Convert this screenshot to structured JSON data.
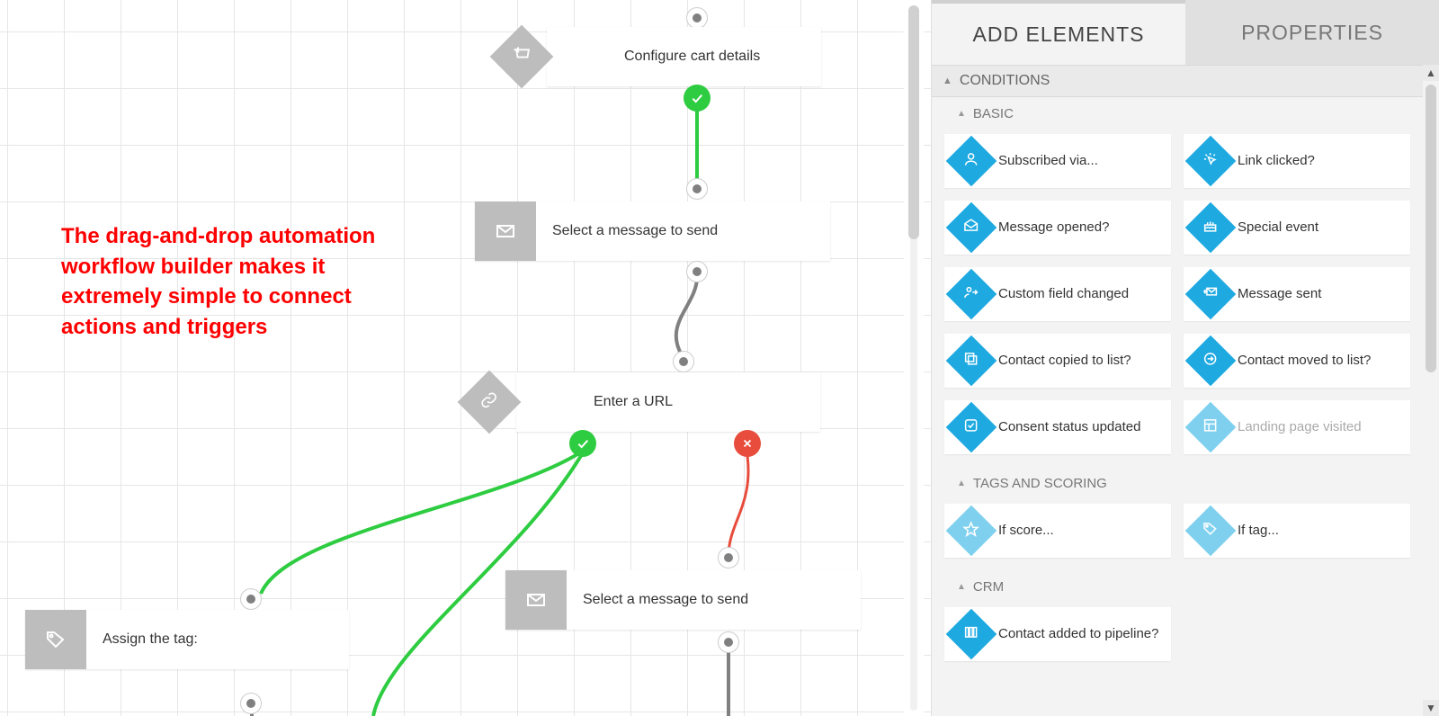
{
  "tabs": {
    "add_elements": "ADD ELEMENTS",
    "properties": "PROPERTIES"
  },
  "sections": {
    "conditions": "CONDITIONS",
    "basic": "BASIC",
    "tags_scoring": "TAGS AND SCORING",
    "crm": "CRM"
  },
  "conditions": {
    "basic": [
      {
        "key": "subscribed-via",
        "label": "Subscribed via...",
        "icon": "person"
      },
      {
        "key": "link-clicked",
        "label": "Link clicked?",
        "icon": "click"
      },
      {
        "key": "message-opened",
        "label": "Message opened?",
        "icon": "envelope-open"
      },
      {
        "key": "special-event",
        "label": "Special event",
        "icon": "cake"
      },
      {
        "key": "custom-field-changed",
        "label": "Custom field changed",
        "icon": "person-arrow"
      },
      {
        "key": "message-sent",
        "label": "Message sent",
        "icon": "envelope-arrow"
      },
      {
        "key": "contact-copied",
        "label": "Contact copied to list?",
        "icon": "copy"
      },
      {
        "key": "contact-moved",
        "label": "Contact moved to list?",
        "icon": "move"
      },
      {
        "key": "consent-updated",
        "label": "Consent status updated",
        "icon": "check-square"
      },
      {
        "key": "landing-page",
        "label": "Landing page visited",
        "icon": "layout",
        "disabled": true
      }
    ],
    "tags_scoring": [
      {
        "key": "if-score",
        "label": "If score...",
        "icon": "star",
        "light": true
      },
      {
        "key": "if-tag",
        "label": "If tag...",
        "icon": "tag",
        "light": true
      }
    ],
    "crm": [
      {
        "key": "contact-pipeline",
        "label": "Contact added to pipeline?",
        "icon": "pipeline"
      }
    ]
  },
  "nodes": {
    "configure_cart": "Configure cart details",
    "select_message_1": "Select a message to send",
    "enter_url": "Enter a URL",
    "select_message_2": "Select a message to send",
    "assign_tag": "Assign the tag:"
  },
  "annotation": "The drag-and-drop automation workflow builder makes it extremely simple to connect actions and triggers"
}
